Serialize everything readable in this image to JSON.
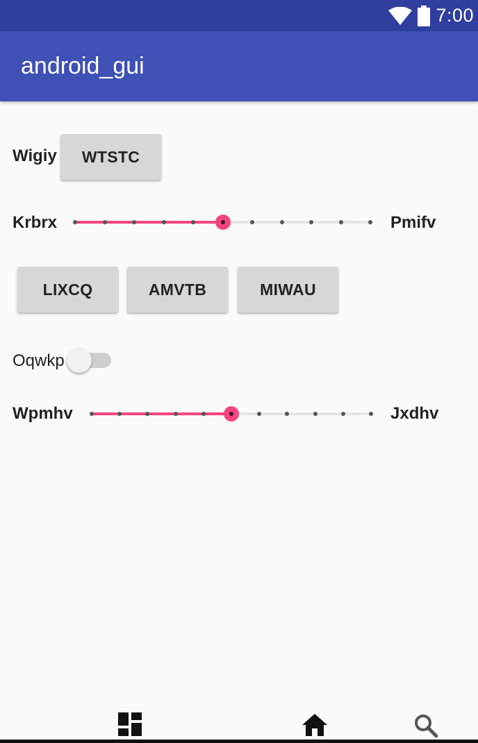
{
  "status_bar": {
    "time": "7:00",
    "icons": [
      "wifi-icon",
      "battery-icon"
    ]
  },
  "app_bar": {
    "title": "android_gui"
  },
  "row1": {
    "label": "Wigiy",
    "button": "WTSTC"
  },
  "slider1": {
    "left_label": "Krbrx",
    "right_label": "Pmifv",
    "value": 5,
    "max": 10
  },
  "buttons_row": [
    "LIXCQ",
    "AMVTB",
    "MIWAU"
  ],
  "switch": {
    "label": "Oqwkp",
    "checked": false
  },
  "slider2": {
    "left_label": "Wpmhv",
    "right_label": "Jxdhv",
    "value": 5,
    "max": 10
  },
  "bottom_nav": {
    "icons": [
      "dashboard-icon",
      "home-icon",
      "search-icon"
    ]
  },
  "colors": {
    "primary": "#3f51b5",
    "primary_dark": "#303f9f",
    "accent": "#f4447f"
  }
}
